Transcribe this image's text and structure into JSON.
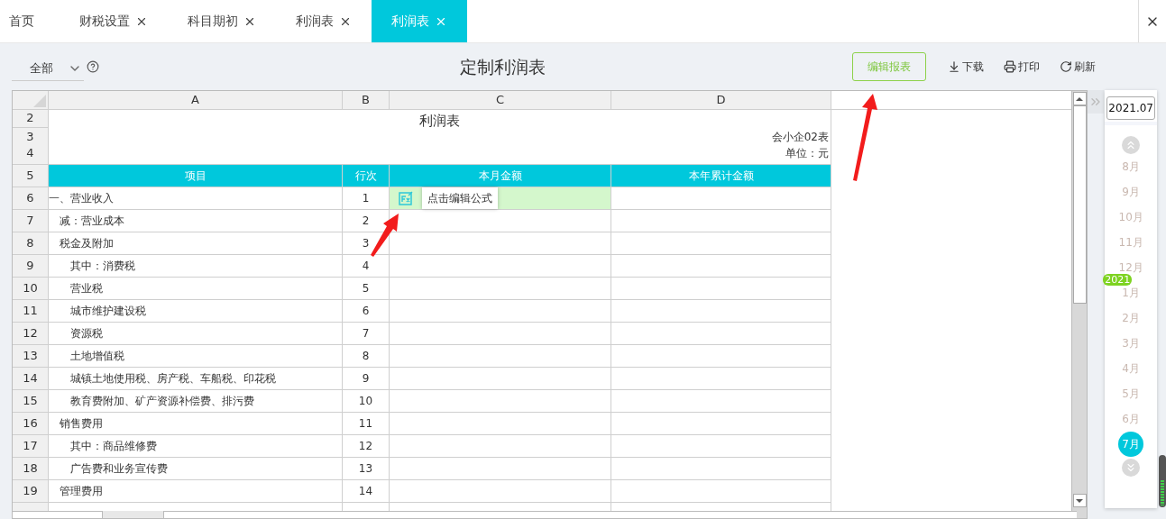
{
  "tabs": [
    {
      "label": "首页",
      "closable": false,
      "selected": false
    },
    {
      "label": "财税设置",
      "closable": true,
      "selected": false
    },
    {
      "label": "科目期初",
      "closable": true,
      "selected": false
    },
    {
      "label": "利润表",
      "closable": true,
      "selected": false
    },
    {
      "label": "利润表",
      "closable": true,
      "selected": true
    }
  ],
  "toolbar": {
    "scope_select": {
      "value": "全部"
    },
    "title": "定制利润表",
    "buttons": [
      {
        "label": "编辑报表",
        "kind": "primary"
      },
      {
        "label": "下载",
        "kind": "download"
      },
      {
        "label": "打印",
        "kind": "print"
      },
      {
        "label": "刷新",
        "kind": "refresh"
      }
    ]
  },
  "sheet": {
    "columns": [
      "A",
      "B",
      "C",
      "D"
    ],
    "row_numbers": [
      "2",
      "3",
      "4",
      "5",
      "6",
      "7",
      "8",
      "9",
      "10",
      "11",
      "12",
      "13",
      "14",
      "15",
      "16",
      "17",
      "18",
      "19"
    ],
    "report_title": "利润表",
    "form_code": "会小企02表",
    "unit": "单位：元",
    "headers": [
      "项目",
      "行次",
      "本月金额",
      "本年累计金额"
    ],
    "rows": [
      {
        "item": "一、营业收入",
        "line": "1",
        "selected": true,
        "children": [
          {
            "item": "减：营业成本",
            "line": "2",
            "selected": false
          },
          {
            "item": "税金及附加",
            "line": "3",
            "selected": false,
            "children": [
              {
                "item": "其中：消费税",
                "line": "4",
                "selected": false
              },
              {
                "item": "营业税",
                "line": "5",
                "selected": false
              },
              {
                "item": "城市维护建设税",
                "line": "6",
                "selected": false
              },
              {
                "item": "资源税",
                "line": "7",
                "selected": false
              },
              {
                "item": "土地增值税",
                "line": "8",
                "selected": false
              },
              {
                "item": "城镇土地使用税、房产税、车船税、印花税",
                "line": "9",
                "selected": false
              },
              {
                "item": "教育费附加、矿产资源补偿费、排污费",
                "line": "10",
                "selected": false
              }
            ]
          },
          {
            "item": "销售费用",
            "line": "11",
            "selected": false,
            "children": [
              {
                "item": "其中：商品维修费",
                "line": "12",
                "selected": false
              },
              {
                "item": "广告费和业务宣传费",
                "line": "13",
                "selected": false
              }
            ]
          },
          {
            "item": "管理费用",
            "line": "14",
            "selected": false
          }
        ]
      }
    ],
    "tooltip": "点击编辑公式"
  },
  "period": {
    "date": "2021.07",
    "months": [
      {
        "label": "8月",
        "selected": false
      },
      {
        "label": "9月",
        "selected": false
      },
      {
        "label": "10月",
        "selected": false
      },
      {
        "label": "11月",
        "selected": false
      },
      {
        "label": "12月",
        "selected": false
      },
      {
        "label": "1月",
        "year": "2021",
        "selected": false
      },
      {
        "label": "2月",
        "selected": false
      },
      {
        "label": "3月",
        "selected": false
      },
      {
        "label": "4月",
        "selected": false
      },
      {
        "label": "5月",
        "selected": false
      },
      {
        "label": "6月",
        "selected": false
      },
      {
        "label": "7月",
        "selected": true
      }
    ]
  }
}
